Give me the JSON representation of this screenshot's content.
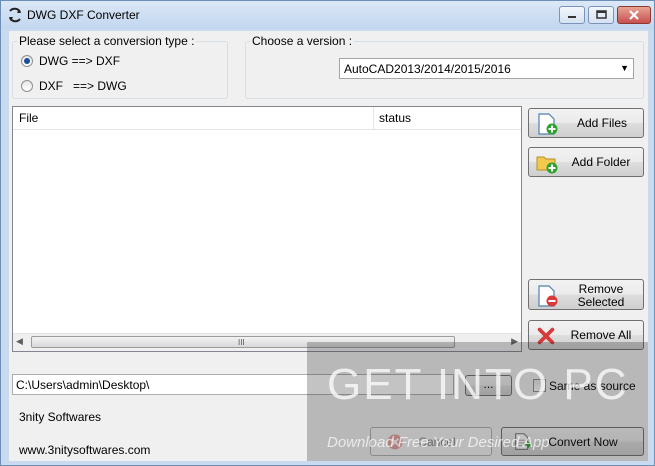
{
  "window": {
    "title": "DWG DXF Converter",
    "controls": {
      "minimize": "minimize-icon",
      "maximize": "maximize-icon",
      "close": "close-icon"
    }
  },
  "conversion": {
    "group_title": "Please select a conversion type :",
    "options": [
      {
        "label": "DWG ==> DXF",
        "selected": true
      },
      {
        "label": "DXF   ==> DWG",
        "selected": false
      }
    ]
  },
  "version": {
    "group_title": "Choose a version :",
    "selected": "AutoCAD2013/2014/2015/2016"
  },
  "file_list": {
    "columns": [
      "File",
      "status"
    ],
    "rows": [],
    "scroll_grip": "III"
  },
  "actions": {
    "add_files": "Add Files",
    "add_folder": "Add Folder",
    "remove_selected_line1": "Remove",
    "remove_selected_line2": "Selected",
    "remove_all": "Remove All"
  },
  "output": {
    "path": "C:\\Users\\admin\\Desktop\\",
    "browse_label": "...",
    "same_as_source_label": "Same as source",
    "same_as_source_checked": false
  },
  "footer": {
    "company": "3nity Softwares",
    "website": "www.3nitysoftwares.com",
    "cancel": "Cancel",
    "convert_now": "Convert Now"
  },
  "watermark": {
    "main": "GET INTO PC",
    "sub": "Download Free Your Desired App"
  },
  "colors": {
    "title_bar": "#c9daee",
    "client": "#f0f0f0",
    "radio_selected": "#1a4f97",
    "close_button": "#c75050",
    "add_icon_green": "#2fa12f",
    "remove_icon_red": "#d63a3a"
  }
}
